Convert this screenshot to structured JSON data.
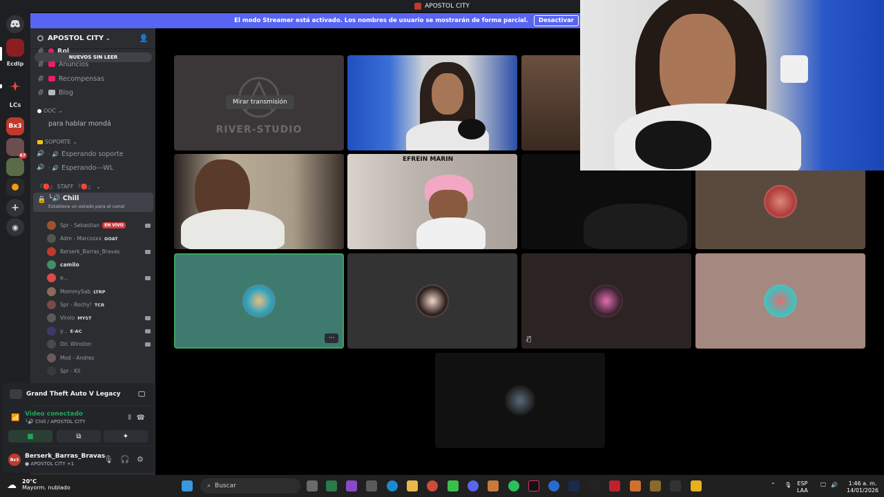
{
  "window": {
    "title": "APOSTOL CITY"
  },
  "banner": {
    "message": "El modo Streamer está activado. Los nombres de usuario se mostrarán de forma parcial.",
    "button": "Desactivar"
  },
  "rail": {
    "items": [
      {
        "name": "discord-home",
        "label": "",
        "color": "#313338"
      },
      {
        "name": "apostol-city",
        "label": "",
        "color": "#8b1e1e"
      },
      {
        "name": "edclp",
        "label": "Ecdlp",
        "color": "#1e1f22"
      },
      {
        "name": "server-red",
        "label": "",
        "color": "#1e1f22"
      },
      {
        "name": "lcs",
        "label": "LCs",
        "color": "#1e1f22"
      },
      {
        "name": "bx3",
        "label": "Bx3",
        "color": "#c0392b"
      },
      {
        "name": "server-67",
        "label": "67",
        "color": "#6b4e4e"
      },
      {
        "name": "server-landscape",
        "label": "",
        "color": "#5a6b4a"
      },
      {
        "name": "server-dark",
        "label": "",
        "color": "#2a2a2a"
      }
    ]
  },
  "sidebar": {
    "server_name": "APOSTOL CITY",
    "unread_pill": "NUEVOS SIN LEER",
    "channels": [
      {
        "label": "Rol",
        "emo": "#e91e63"
      },
      {
        "label": "Anuncios",
        "emo": "#e91e63"
      },
      {
        "label": "Recompensas",
        "emo": "#e91e63"
      },
      {
        "label": "Blog",
        "emo": "#b5bac1"
      }
    ],
    "ooc_category": "OOC",
    "ooc_channel": "para hablar mondá",
    "soporte_category": "SOPORTE",
    "soporte_channels": [
      "Esperando soporte",
      "Esperando---WL"
    ],
    "staff_category": "『🔴』 STAFF 『🔴』",
    "chill": {
      "name": "Chill",
      "status": "Establece un estado para el canal"
    },
    "members": [
      {
        "name": "Spr - Sebastian",
        "tag": "EN VIVO",
        "color": "#a0522d",
        "bold": false,
        "cam": true
      },
      {
        "name": "Adm - Marcosxx",
        "tag": "GOAT",
        "color": "#555",
        "bold": false,
        "cam": false
      },
      {
        "name": "Berserk_Barras_Bravas",
        "tag": "",
        "color": "#c0392b",
        "bold": false,
        "cam": true
      },
      {
        "name": "camilo",
        "tag": "",
        "color": "#3f8f6a",
        "bold": true,
        "cam": false
      },
      {
        "name": "e...",
        "tag": "",
        "color": "#d94b4b",
        "bold": false,
        "cam": true
      },
      {
        "name": "MommySab",
        "tag": "LTRP",
        "color": "#8a6b5a",
        "bold": false,
        "cam": false
      },
      {
        "name": "Spr - Rochy!",
        "tag": "TCR",
        "color": "#7a4a4a",
        "bold": false,
        "cam": false
      },
      {
        "name": "Virolo",
        "tag": "MYST",
        "color": "#5a5a5a",
        "bold": false,
        "cam": true
      },
      {
        "name": "y...",
        "tag": "E-AC",
        "color": "#3a3a6a",
        "bold": false,
        "cam": true
      },
      {
        "name": "Dir. Winston",
        "tag": "",
        "color": "#4a4a4a",
        "bold": false,
        "cam": true
      },
      {
        "name": "Mod - Andres",
        "tag": "",
        "color": "#6a5a5a",
        "bold": false,
        "cam": false
      },
      {
        "name": "Spr - Kll",
        "tag": "",
        "color": "#3a3a3a",
        "bold": false,
        "cam": false
      }
    ]
  },
  "activity": {
    "game": "Grand Theft Auto V Legacy"
  },
  "voice": {
    "status": "Video conectado",
    "channel": "Chill / APOSTOL CITY"
  },
  "user": {
    "avatar": "Bx3",
    "name": "Berserk_Barras_Bravas",
    "status": "APOSTOL CITY +1"
  },
  "stage": {
    "river_logo": "RIVER-STUDIO",
    "watch_button": "Mirar transmisión",
    "tile_label": "EFREIN MARIN",
    "more": "···"
  },
  "taskbar": {
    "temp": "20°C",
    "weather": "Mayorm. nublado",
    "search": "Buscar",
    "lang": "ESP",
    "layout": "LAA",
    "time": "1:46 a. m.",
    "date": "14/01/2026"
  }
}
